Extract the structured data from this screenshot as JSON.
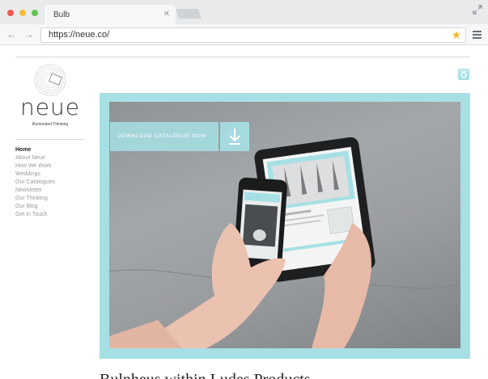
{
  "browser": {
    "tab_title": "Bulb",
    "url": "https://neue.co/"
  },
  "site": {
    "logo_text": "neue",
    "tagline": "Illuminated Thinking",
    "nav": [
      {
        "label": "Home",
        "active": true
      },
      {
        "label": "About Neue"
      },
      {
        "label": "How We Work"
      },
      {
        "label": "Weddings"
      },
      {
        "label": "Our Catalogues"
      },
      {
        "label": "Newsletter"
      },
      {
        "label": "Our Thinking"
      },
      {
        "label": "Our Blog"
      },
      {
        "label": "Get In Touch"
      }
    ],
    "hero": {
      "download_label": "DOWNLOAD CATALOGUE NOW"
    },
    "heading_below": "Bulnheus within Ludes Products"
  },
  "colors": {
    "accent": "#a6e0e4",
    "star": "#f3b731"
  }
}
